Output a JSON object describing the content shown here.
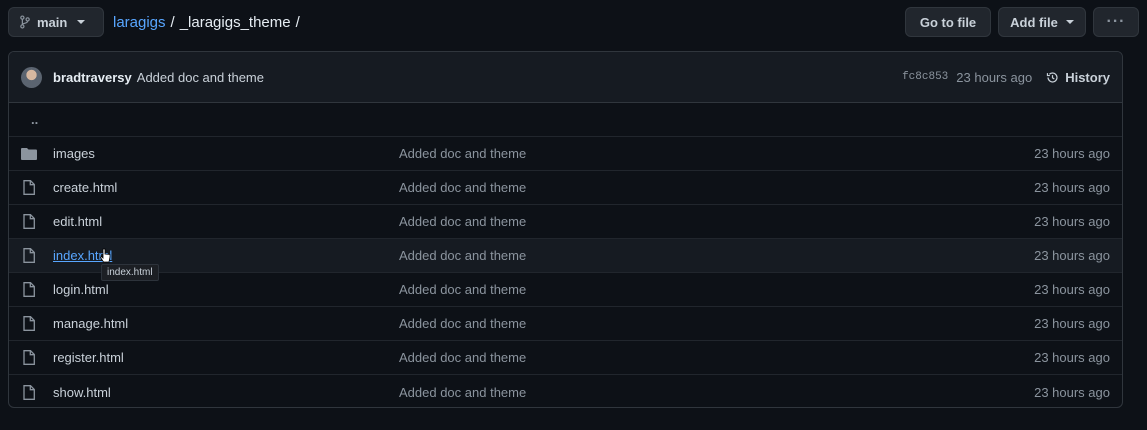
{
  "topbar": {
    "branch": "main",
    "breadcrumb": {
      "repo": "laragigs",
      "sep1": "/",
      "folder": "_laragigs_theme",
      "sep2": "/"
    },
    "goto_label": "Go to file",
    "add_file_label": "Add file",
    "more_label": "···"
  },
  "commit": {
    "author": "bradtraversy",
    "message": "Added doc and theme",
    "sha": "fc8c853",
    "time": "23 hours ago",
    "history_label": "History"
  },
  "updir": "..",
  "files": [
    {
      "type": "dir",
      "name": "images",
      "message": "Added doc and theme",
      "time": "23 hours ago"
    },
    {
      "type": "file",
      "name": "create.html",
      "message": "Added doc and theme",
      "time": "23 hours ago"
    },
    {
      "type": "file",
      "name": "edit.html",
      "message": "Added doc and theme",
      "time": "23 hours ago"
    },
    {
      "type": "file",
      "name": "index.html",
      "message": "Added doc and theme",
      "time": "23 hours ago"
    },
    {
      "type": "file",
      "name": "login.html",
      "message": "Added doc and theme",
      "time": "23 hours ago"
    },
    {
      "type": "file",
      "name": "manage.html",
      "message": "Added doc and theme",
      "time": "23 hours ago"
    },
    {
      "type": "file",
      "name": "register.html",
      "message": "Added doc and theme",
      "time": "23 hours ago"
    },
    {
      "type": "file",
      "name": "show.html",
      "message": "Added doc and theme",
      "time": "23 hours ago"
    }
  ],
  "tooltip": "index.html",
  "colors": {
    "background": "#0d1117",
    "link": "#58a6ff",
    "border": "#30363d"
  }
}
